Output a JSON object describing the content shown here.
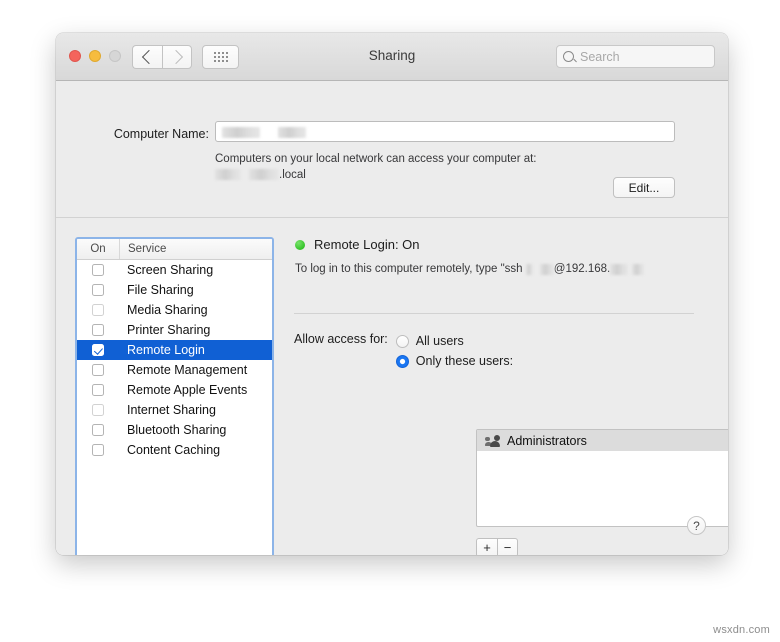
{
  "window": {
    "title": "Sharing",
    "traffic_lights": [
      "close",
      "minimize",
      "zoom"
    ],
    "nav": {
      "back": "back-chevron",
      "forward": "forward-chevron",
      "grid": "show-all-grid"
    },
    "search": {
      "placeholder": "Search",
      "value": "",
      "icon": "search-icon"
    }
  },
  "computer_name": {
    "label": "Computer Name:",
    "value": "",
    "note": "Computers on your local network can access your computer at:",
    "hostname_suffix": ".local",
    "edit_button": "Edit..."
  },
  "services": {
    "columns": {
      "on": "On",
      "service": "Service"
    },
    "items": [
      {
        "name": "Screen Sharing",
        "checked": false,
        "selected": false,
        "dimmed": false
      },
      {
        "name": "File Sharing",
        "checked": false,
        "selected": false,
        "dimmed": false
      },
      {
        "name": "Media Sharing",
        "checked": false,
        "selected": false,
        "dimmed": true
      },
      {
        "name": "Printer Sharing",
        "checked": false,
        "selected": false,
        "dimmed": false
      },
      {
        "name": "Remote Login",
        "checked": true,
        "selected": true,
        "dimmed": false
      },
      {
        "name": "Remote Management",
        "checked": false,
        "selected": false,
        "dimmed": false
      },
      {
        "name": "Remote Apple Events",
        "checked": false,
        "selected": false,
        "dimmed": false
      },
      {
        "name": "Internet Sharing",
        "checked": false,
        "selected": false,
        "dimmed": true
      },
      {
        "name": "Bluetooth Sharing",
        "checked": false,
        "selected": false,
        "dimmed": false
      },
      {
        "name": "Content Caching",
        "checked": false,
        "selected": false,
        "dimmed": false
      }
    ]
  },
  "detail": {
    "status_label": "Remote Login: On",
    "status_color": "#34c329",
    "hint_prefix": "To log in to this computer remotely, type \"ssh ",
    "hint_middle": "@192.168.",
    "access_label": "Allow access for:",
    "option_all_users": "All users",
    "option_only_these": "Only these users:",
    "selected_option": "only_these_users",
    "users": [
      {
        "name": "Administrators",
        "icon": "group-icon"
      }
    ],
    "add_button": "+",
    "remove_button": "−"
  },
  "help_button": "?",
  "watermark": "wsxdn.com",
  "accent_color": "#1060d4"
}
